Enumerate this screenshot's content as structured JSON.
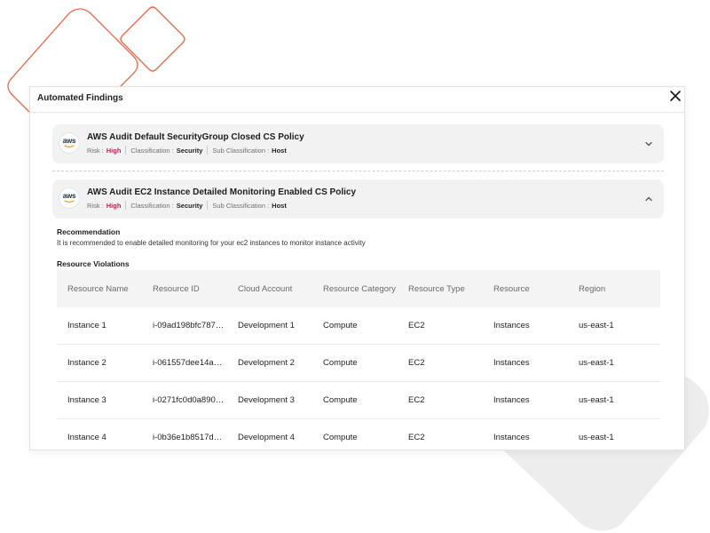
{
  "panel": {
    "title": "Automated Findings",
    "close_icon": "close-icon"
  },
  "findings": [
    {
      "logo_text": "aws",
      "title": "AWS Audit Default SecurityGroup Closed CS Policy",
      "risk_label": "Risk :",
      "risk_value": "High",
      "classification_label": "Classification :",
      "classification_value": "Security",
      "sub_classification_label": "Sub Classification :",
      "sub_classification_value": "Host",
      "expanded": false,
      "chevron_icon": "chevron-down-icon"
    },
    {
      "logo_text": "aws",
      "title": "AWS Audit EC2 Instance Detailed Monitoring Enabled CS Policy",
      "risk_label": "Risk :",
      "risk_value": "High",
      "classification_label": "Classification :",
      "classification_value": "Security",
      "sub_classification_label": "Sub Classification :",
      "sub_classification_value": "Host",
      "expanded": true,
      "chevron_icon": "chevron-up-icon"
    }
  ],
  "details": {
    "recommendation_label": "Recommendation",
    "recommendation_text": "It is recommended to enable detailed monitoring for your ec2 instances to monitor instance activity",
    "resource_violations_label": "Resource Violations",
    "columns": [
      "Resource Name",
      "Resource ID",
      "Cloud Account",
      "Resource Category",
      "Resource Type",
      "Resource",
      "Region"
    ],
    "rows": [
      [
        "Instance 1",
        "i-09ad198bfc787…",
        "Development 1",
        "Compute",
        "EC2",
        "Instances",
        "us-east-1"
      ],
      [
        "Instance 2",
        "i-061557dee14a…",
        "Development 2",
        "Compute",
        "EC2",
        "Instances",
        "us-east-1"
      ],
      [
        "Instance 3",
        "i-0271fc0d0a890…",
        "Development 3",
        "Compute",
        "EC2",
        "Instances",
        "us-east-1"
      ],
      [
        "Instance 4",
        "i-0b36e1b8517d…",
        "Development 4",
        "Compute",
        "EC2",
        "Instances",
        "us-east-1"
      ]
    ]
  },
  "colors": {
    "accent_decor": "#dd6a4a",
    "risk_high": "#b0245c",
    "grey_blob": "#ededed"
  }
}
